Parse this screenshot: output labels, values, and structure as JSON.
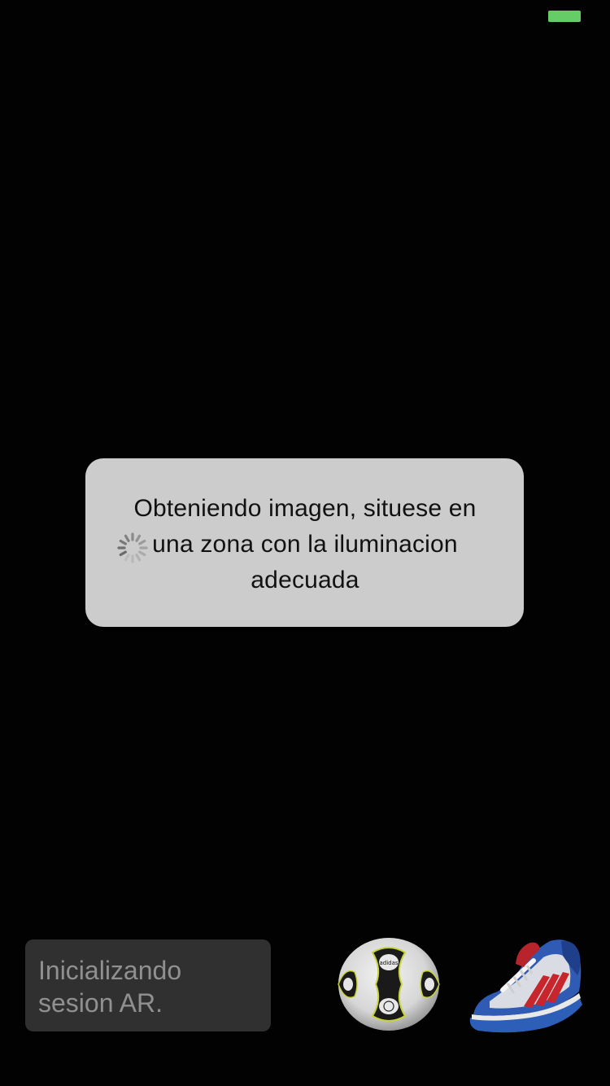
{
  "status_bar": {
    "battery_icon": "battery-icon",
    "battery_color": "#66cc66"
  },
  "loading_dialog": {
    "message": "Obteniendo imagen, situese en una zona con la iluminacion adecuada",
    "spinner_icon": "spinner-icon",
    "background_color": "#cccccc"
  },
  "status_panel": {
    "text": "Inicializando\nsesion AR."
  },
  "models": [
    {
      "icon": "soccer-ball-icon",
      "logo_text": "adidas"
    },
    {
      "icon": "sneaker-icon"
    }
  ]
}
